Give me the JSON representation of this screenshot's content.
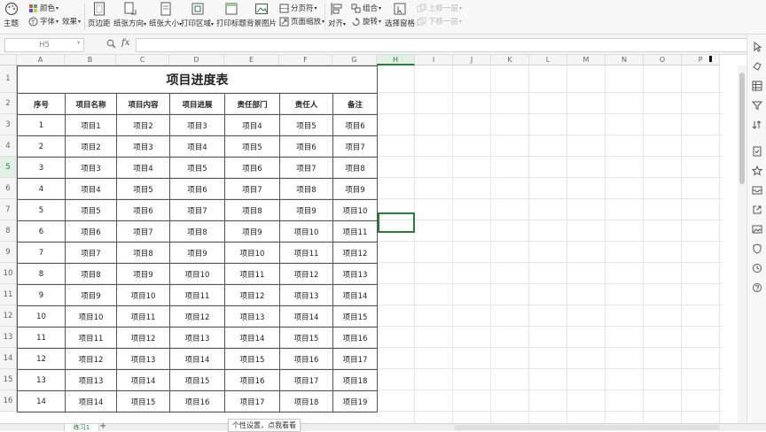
{
  "ribbon": {
    "theme": "主题",
    "color": "颜色",
    "font": "字体",
    "effect": "效果",
    "margin": "页边距",
    "orientation": "纸张方向",
    "size": "纸张大小",
    "print_area": "打印区域",
    "print_titles": "打印标题",
    "background": "背景图片",
    "page_break": "分页符",
    "page_zoom": "页面缩放",
    "align": "对齐",
    "group": "组合",
    "rotate": "旋转",
    "selection_pane": "选择窗格",
    "bring_up": "上移一层",
    "send_down": "下移一层"
  },
  "formula_bar": {
    "name_box": "H5",
    "fx": "fx",
    "value": ""
  },
  "columns": [
    "A",
    "B",
    "C",
    "D",
    "E",
    "F",
    "G",
    "H",
    "I",
    "J",
    "K",
    "L",
    "M",
    "N",
    "O",
    "P"
  ],
  "selected_column": "H",
  "rows": [
    "1",
    "2",
    "3",
    "4",
    "5",
    "6",
    "7",
    "8",
    "9",
    "10",
    "11",
    "12",
    "13",
    "14",
    "15",
    "16"
  ],
  "selected_row": "5",
  "table": {
    "title": "项目进度表",
    "headers": [
      "序号",
      "项目名称",
      "项目内容",
      "项目进展",
      "责任部门",
      "责任人",
      "备注"
    ],
    "rows": [
      [
        "1",
        "项目1",
        "项目2",
        "项目3",
        "项目4",
        "项目5",
        "项目6"
      ],
      [
        "2",
        "项目2",
        "项目3",
        "项目4",
        "项目5",
        "项目6",
        "项目7"
      ],
      [
        "3",
        "项目3",
        "项目4",
        "项目5",
        "项目6",
        "项目7",
        "项目8"
      ],
      [
        "4",
        "项目4",
        "项目5",
        "项目6",
        "项目7",
        "项目8",
        "项目9"
      ],
      [
        "5",
        "项目5",
        "项目6",
        "项目7",
        "项目8",
        "项目9",
        "项目10"
      ],
      [
        "6",
        "项目6",
        "项目7",
        "项目8",
        "项目9",
        "项目10",
        "项目11"
      ],
      [
        "7",
        "项目7",
        "项目8",
        "项目9",
        "项目10",
        "项目11",
        "项目12"
      ],
      [
        "8",
        "项目8",
        "项目9",
        "项目10",
        "项目11",
        "项目12",
        "项目13"
      ],
      [
        "9",
        "项目9",
        "项目10",
        "项目11",
        "项目12",
        "项目13",
        "项目14"
      ],
      [
        "10",
        "项目10",
        "项目11",
        "项目12",
        "项目13",
        "项目14",
        "项目15"
      ],
      [
        "11",
        "项目11",
        "项目12",
        "项目13",
        "项目14",
        "项目15",
        "项目16"
      ],
      [
        "12",
        "项目12",
        "项目13",
        "项目14",
        "项目15",
        "项目16",
        "项目17"
      ],
      [
        "13",
        "项目13",
        "项目14",
        "项目15",
        "项目16",
        "项目17",
        "项目18"
      ],
      [
        "14",
        "项目14",
        "项目15",
        "项目16",
        "项目17",
        "项目18",
        "项目19"
      ]
    ]
  },
  "sheet_tab": "练习1",
  "add_sheet": "+",
  "tooltip": "个性设置，点我看看",
  "colors": {
    "accent": "#2b7a3d",
    "selected_header_bg": "#e2efe5",
    "border": "#555555"
  }
}
